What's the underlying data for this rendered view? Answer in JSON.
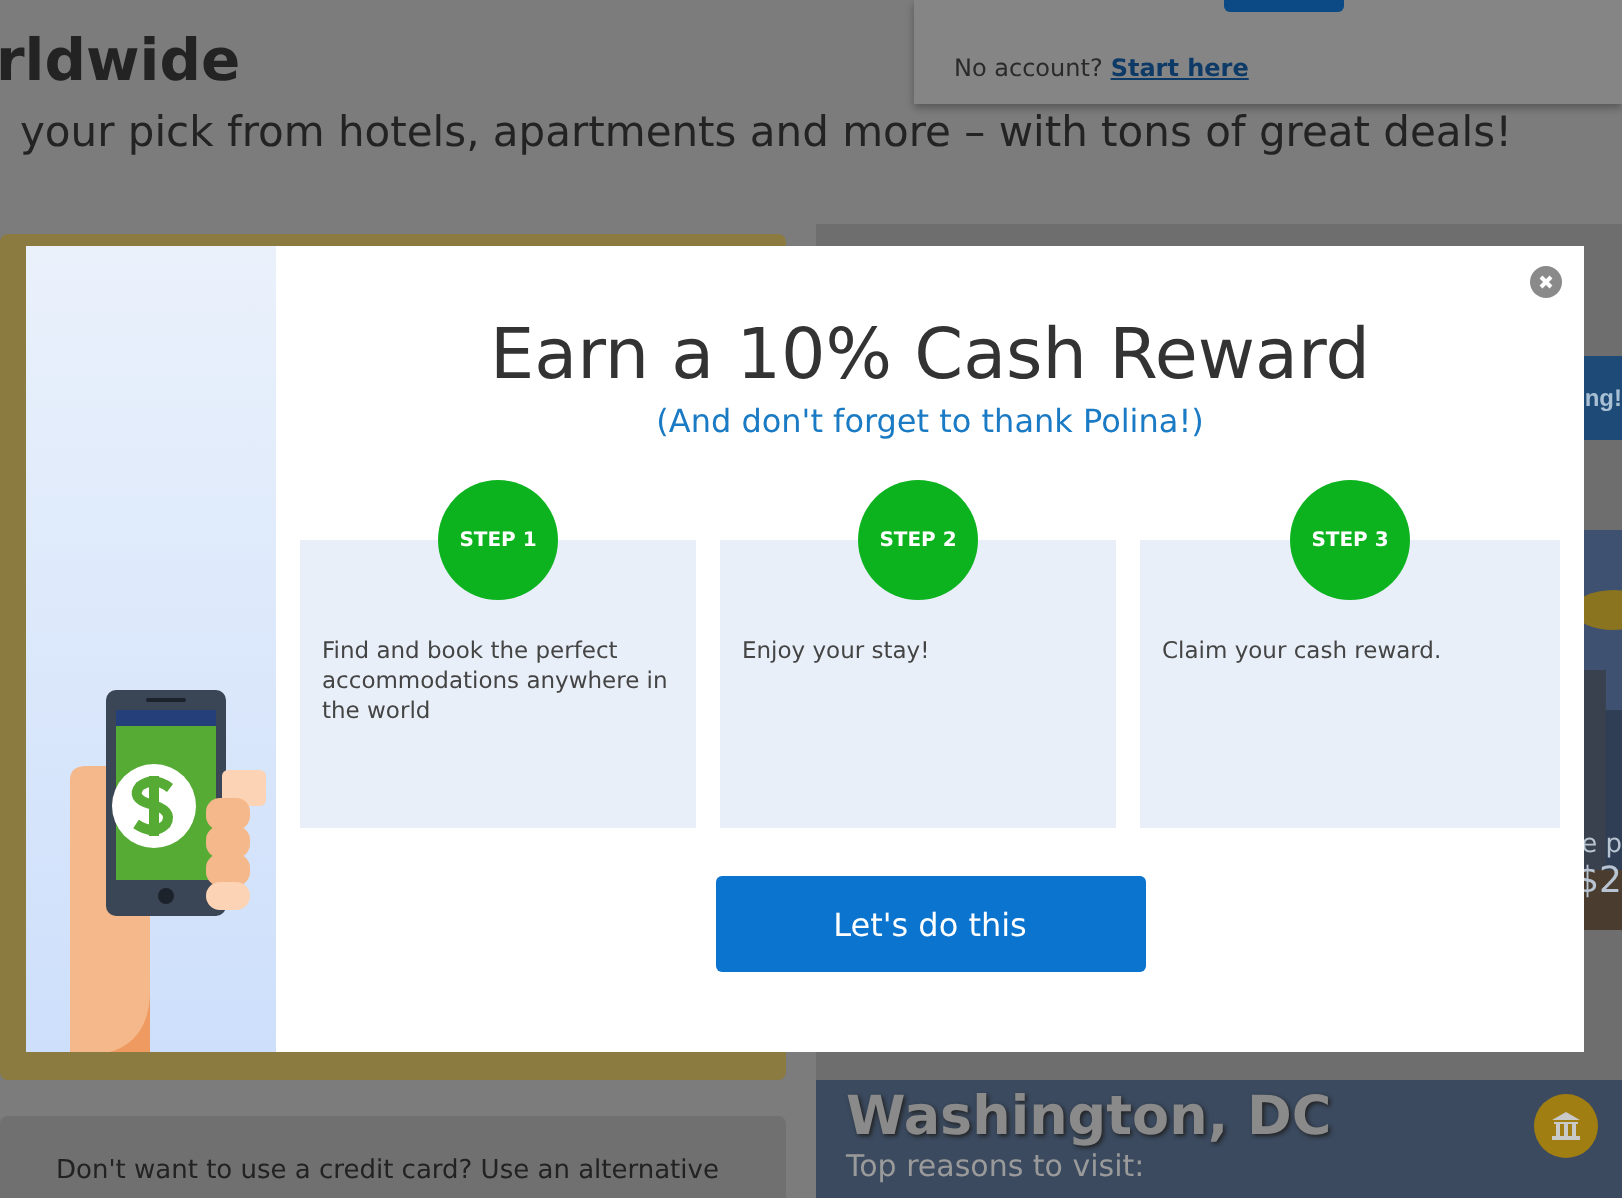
{
  "background_page": {
    "headline_lines": [
      "rldwide"
    ],
    "subtitle": "your pick from hotels, apartments and more – with tons of great deals!",
    "signin_popup": {
      "prompt": "No account?",
      "link": "Start here"
    },
    "promo_banner": {
      "text": "ng!"
    },
    "city_card": {
      "caption": "e p",
      "price": "$2"
    },
    "payment_note": "Don't want to use a credit card? Use an alternative",
    "destination": {
      "title": "Washington, DC",
      "subtitle": "Top reasons to visit:"
    }
  },
  "modal": {
    "title": "Earn a 10% Cash Reward",
    "subtitle": "(And don't forget to thank Polina!)",
    "steps": [
      {
        "badge": "STEP 1",
        "text": "Find and book the perfect accommodations anywhere in the world"
      },
      {
        "badge": "STEP 2",
        "text": "Enjoy your stay!"
      },
      {
        "badge": "STEP 3",
        "text": "Claim your cash reward."
      }
    ],
    "button": "Let's do this"
  }
}
